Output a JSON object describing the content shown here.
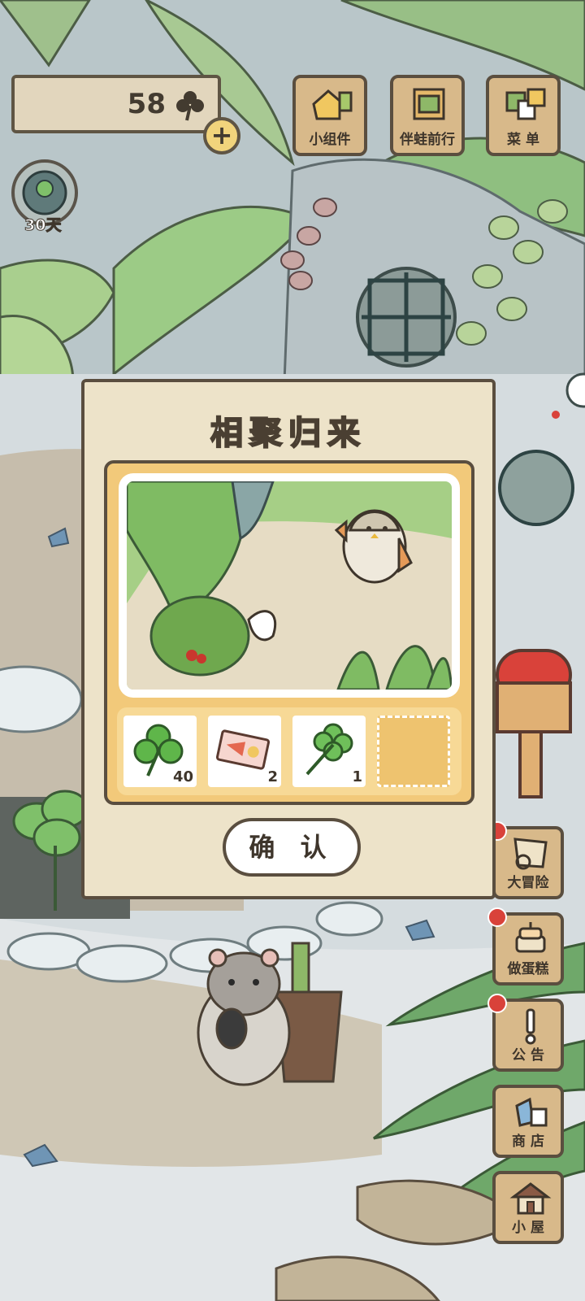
{
  "clover_counter": {
    "count": "58"
  },
  "add_label": "+",
  "day_badge": {
    "text": "30天"
  },
  "top_buttons": [
    {
      "label": "小组件",
      "icon": "widget-icon"
    },
    {
      "label": "伴蛙前行",
      "icon": "journey-icon"
    },
    {
      "label": "菜 单",
      "icon": "menu-icon"
    }
  ],
  "side_buttons": [
    {
      "label": "大冒险",
      "icon": "adventure-icon",
      "badge": true
    },
    {
      "label": "做蛋糕",
      "icon": "cake-icon",
      "badge": true
    },
    {
      "label": "公 告",
      "icon": "announcement-icon",
      "badge": true
    },
    {
      "label": "商 店",
      "icon": "shop-icon",
      "badge": false
    },
    {
      "label": "小 屋",
      "icon": "house-icon",
      "badge": false
    }
  ],
  "dialog": {
    "title": "相聚归来",
    "items": [
      {
        "icon": "clover-icon",
        "qty": "40"
      },
      {
        "icon": "ticket-icon",
        "qty": "2"
      },
      {
        "icon": "four-leaf-clover-icon",
        "qty": "1"
      },
      {
        "icon": "",
        "qty": ""
      }
    ],
    "confirm_label": "确 认"
  },
  "colors": {
    "panel": "#ede3c9",
    "album": "#f2c97a",
    "button_wood": "#d8b98a",
    "outline": "#5a4e3f",
    "badge_red": "#d9423a"
  }
}
